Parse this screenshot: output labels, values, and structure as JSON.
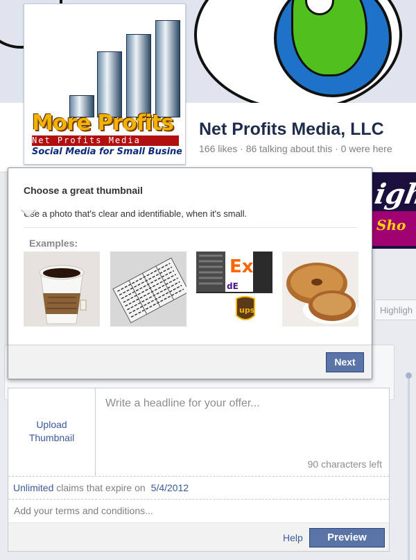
{
  "page": {
    "name": "Net Profits Media, LLC",
    "stats": "166 likes · 86 talking about this · 0 were here",
    "logo": {
      "main_text": "More Profits",
      "sub_text": "Net Profits Media",
      "tagline": "Social Media for Small Business"
    },
    "side_tab": "Highligh"
  },
  "thumbnail_popover": {
    "title": "Choose a great thumbnail",
    "description": "Use a photo that's clear and identifiable, when it's small.",
    "examples_label": "Examples:",
    "examples": [
      {
        "subject": "coffee cup"
      },
      {
        "subject": "newspaper"
      },
      {
        "subject": "shipping logos"
      },
      {
        "subject": "bagel"
      }
    ],
    "next_label": "Next"
  },
  "offer_composer": {
    "upload_label_line1": "Upload",
    "upload_label_line2": "Thumbnail",
    "headline_placeholder": "Write a headline for your offer...",
    "chars_left": "90 characters left",
    "claims_link": "Unlimited",
    "claims_text": " claims that expire on",
    "expire_date": "5/4/2012",
    "terms_placeholder": "Add your terms and conditions...",
    "help_label": "Help",
    "preview_label": "Preview"
  },
  "colors": {
    "fb_blue_button": "#5b74a8",
    "link_blue": "#3b5998",
    "page_bg": "#e9ebee"
  }
}
